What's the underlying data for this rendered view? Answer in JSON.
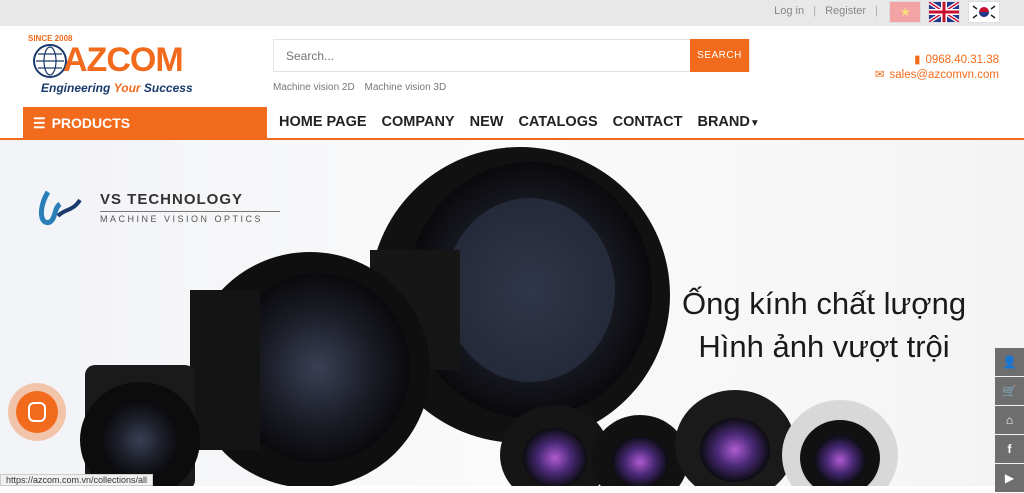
{
  "topbar": {
    "login": "Log in",
    "separator": "|",
    "register": "Register",
    "separator2": "|"
  },
  "flags": [
    {
      "name": "vietnam-flag",
      "glyph": "★"
    },
    {
      "name": "uk-flag"
    },
    {
      "name": "korea-flag"
    }
  ],
  "logo": {
    "since": "SINCE 2008",
    "name": "AZCOM",
    "tagline_a": "Engineering ",
    "tagline_b": "Your",
    "tagline_c": " Success"
  },
  "search": {
    "placeholder": "Search...",
    "button_label": "SEARCH"
  },
  "quicklinks": [
    "Machine vision 2D",
    "Machine vision 3D"
  ],
  "contact": {
    "phone": "0968.40.31.38",
    "email": "sales@azcomvn.com"
  },
  "colors": {
    "accent": "#f26a1b",
    "brand_blue": "#1a3a6b"
  },
  "nav": {
    "products_label": "PRODUCTS",
    "items": [
      "HOME PAGE",
      "COMPANY",
      "NEW",
      "CATALOGS",
      "CONTACT",
      "BRAND"
    ]
  },
  "banner": {
    "brand_title": "VS TECHNOLOGY",
    "brand_subtitle": "MACHINE VISION OPTICS",
    "headline_line1": "Ống kính chất lượng",
    "headline_line2": "Hình ảnh vượt trội"
  },
  "sidebar_icons": [
    "user-icon",
    "cart-icon",
    "home-icon",
    "facebook-icon",
    "youtube-icon"
  ],
  "status_url": "https://azcom.com.vn/collections/all"
}
